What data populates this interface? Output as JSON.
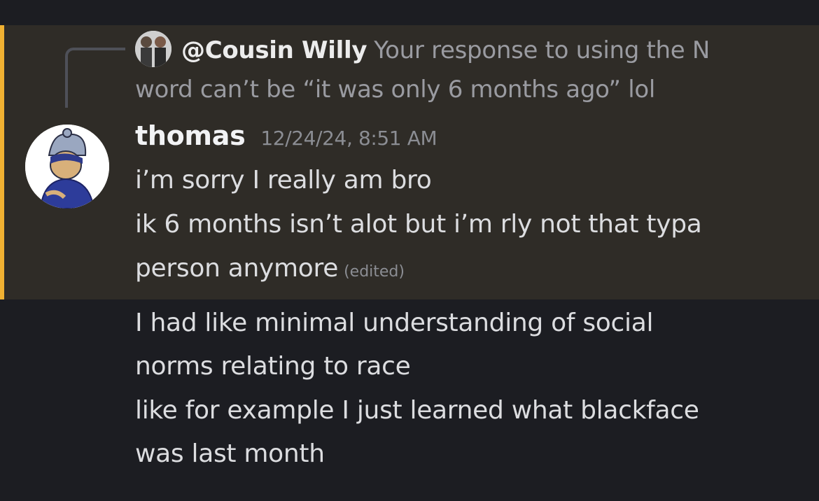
{
  "reply": {
    "author": "@Cousin Willy",
    "text": "Your response to using the N word can’t be “it was only 6 months ago” lol"
  },
  "message": {
    "username": "thomas",
    "timestamp": "12/24/24, 8:51 AM",
    "lines": [
      "i’m sorry I really am bro",
      "ik 6 months isn’t alot but i’m rly not that typa",
      "person anymore"
    ],
    "edited_label": "(edited)"
  },
  "followups": [
    "I had like minimal understanding of social",
    "norms relating to race",
    "like for example I just learned what blackface",
    "was last month"
  ],
  "colors": {
    "background": "#1c1d22",
    "mention_highlight": "#2f2c27",
    "mention_bar": "#f0b132"
  }
}
